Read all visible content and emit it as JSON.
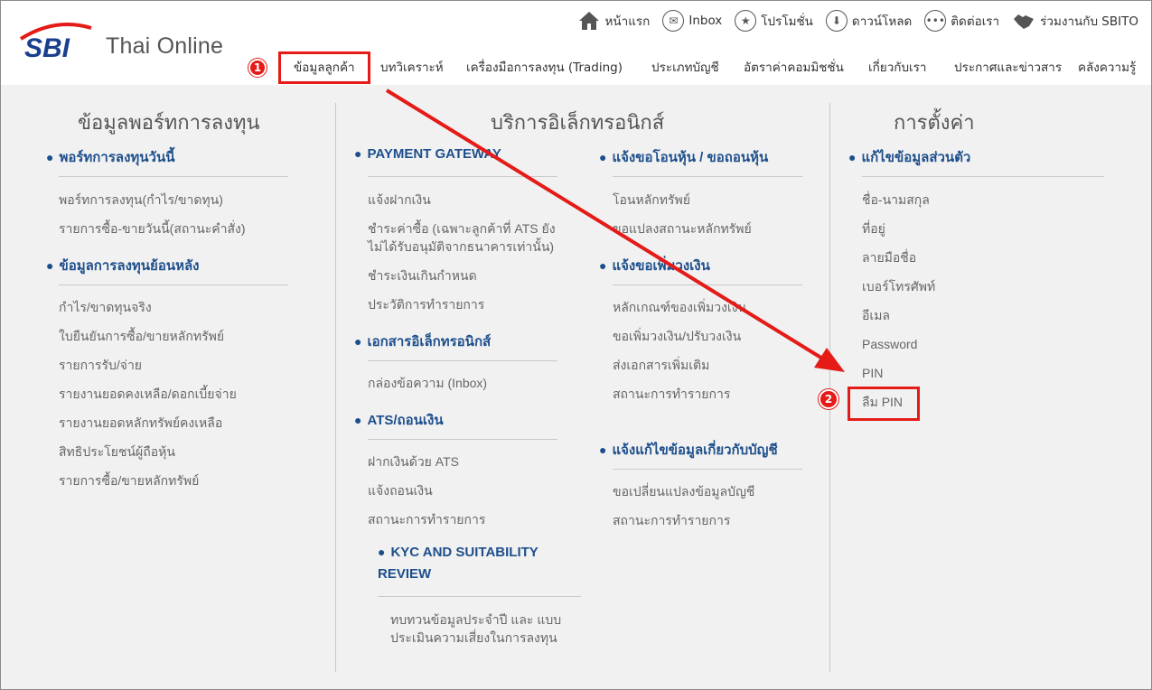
{
  "brand": {
    "logo_mark": "SBI",
    "logo_text": "Thai Online"
  },
  "toplinks": [
    {
      "label": "หน้าแรก",
      "icon": "home-icon"
    },
    {
      "label": "Inbox",
      "icon": "mail-icon"
    },
    {
      "label": "โปรโมชั่น",
      "icon": "star-icon"
    },
    {
      "label": "ดาวน์โหลด",
      "icon": "download-icon"
    },
    {
      "label": "ติดต่อเรา",
      "icon": "chat-icon"
    },
    {
      "label": "ร่วมงานกับ SBITO",
      "icon": "handshake-icon"
    }
  ],
  "annotations": {
    "badge1": "1",
    "badge2": "2"
  },
  "nav": [
    {
      "label": "ข้อมูลลูกค้า"
    },
    {
      "label": "บทวิเคราะห์"
    },
    {
      "label": "เครื่องมือการลงทุน (Trading)"
    },
    {
      "label": "ประเภทบัญชี"
    },
    {
      "label": "อัตราค่าคอมมิชชั่น"
    },
    {
      "label": "เกี่ยวกับเรา"
    },
    {
      "label": "ประกาศและข่าวสาร"
    },
    {
      "label": "คลังความรู้"
    }
  ],
  "col1": {
    "title": "ข้อมูลพอร์ทการลงทุน",
    "sec1": {
      "title": "พอร์ทการลงทุนวันนี้",
      "items": [
        "พอร์ทการลงทุน(กำไร/ขาดทุน)",
        "รายการซื้อ-ขายวันนี้(สถานะคำสั่ง)"
      ]
    },
    "sec2": {
      "title": "ข้อมูลการลงทุนย้อนหลัง",
      "items": [
        "กำไร/ขาดทุนจริง",
        "ใบยืนยันการซื้อ/ขายหลักทรัพย์",
        "รายการรับ/จ่าย",
        "รายงานยอดคงเหลือ/ดอกเบี้ยจ่าย",
        "รายงานยอดหลักทรัพย์คงเหลือ",
        "สิทธิประโยชน์ผู้ถือหุ้น",
        "รายการซื้อ/ขายหลักทรัพย์"
      ]
    }
  },
  "col2": {
    "title": "บริการอิเล็กทรอนิกส์",
    "payment": {
      "title": "PAYMENT GATEWAY",
      "items": [
        "แจ้งฝากเงิน",
        "ชำระค่าซื้อ (เฉพาะลูกค้าที่ ATS ยัง",
        "ไม่ได้รับอนุมัติจากธนาคารเท่านั้น)",
        "ชำระเงินเกินกำหนด",
        "ประวัติการทำรายการ"
      ]
    },
    "edoc": {
      "title": "เอกสารอิเล็กทรอนิกส์",
      "items": [
        "กล่องข้อความ (Inbox)"
      ]
    },
    "ats": {
      "title": "ATS/ถอนเงิน",
      "items": [
        "ฝากเงินด้วย ATS",
        "แจ้งถอนเงิน",
        "สถานะการทำรายการ"
      ]
    },
    "kyc": {
      "title1": "KYC AND SUITABILITY",
      "title2": "REVIEW",
      "items": [
        "ทบทวนข้อมูลประจำปี และ แบบ",
        "ประเมินความเสี่ยงในการลงทุน"
      ]
    },
    "transfer": {
      "title": "แจ้งขอโอนหุ้น / ขอถอนหุ้น",
      "items": [
        "โอนหลักทรัพย์",
        "ขอแปลงสถานะหลักทรัพย์"
      ]
    },
    "credit": {
      "title": "แจ้งขอเพิ่มวงเงิน",
      "items": [
        "หลักเกณฑ์ของเพิ่มวงเงิน",
        "ขอเพิ่มวงเงิน/ปรับวงเงิน",
        "ส่งเอกสารเพิ่มเติม",
        "สถานะการทำรายการ"
      ]
    },
    "account": {
      "title": "แจ้งแก้ไขข้อมูลเกี่ยวกับบัญชี",
      "items": [
        "ขอเปลี่ยนแปลงข้อมูลบัญชี",
        "สถานะการทำรายการ"
      ]
    }
  },
  "col3": {
    "title": "การตั้งค่า",
    "sec": {
      "title": "แก้ไขข้อมูลส่วนตัว",
      "items": [
        "ชื่อ-นามสกุล",
        "ที่อยู่",
        "ลายมือชื่อ",
        "เบอร์โทรศัพท์",
        "อีเมล",
        "Password",
        "PIN",
        "ลืม PIN"
      ]
    }
  },
  "colors": {
    "accent_red": "#e41b17",
    "link_blue": "#1e4f8c",
    "brand_blue": "#1b3f8f"
  }
}
